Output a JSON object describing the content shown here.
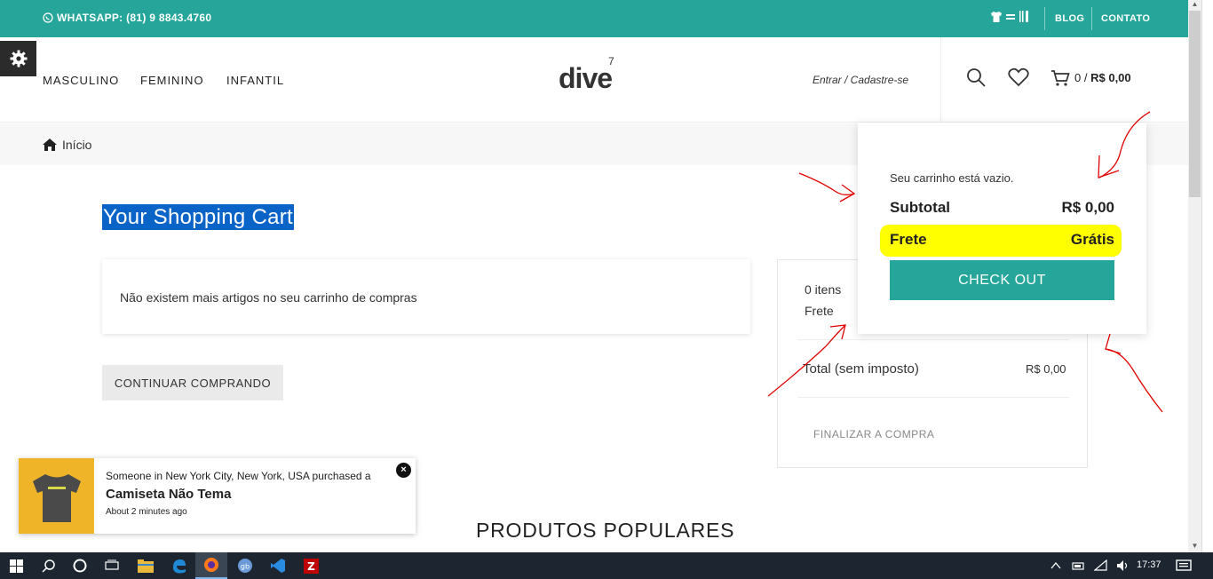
{
  "topbar": {
    "whatsapp": "WHATSAPP: (81) 9 8843.4760",
    "blog": "BLOG",
    "contato": "CONTATO"
  },
  "nav": {
    "items": [
      "MASCULINO",
      "FEMININO",
      "INFANTIL"
    ]
  },
  "logo": {
    "text": "dive",
    "sup": "7"
  },
  "header": {
    "login": "Entrar / Cadastre-se",
    "cart_count": "0",
    "cart_sep": "/",
    "cart_total": "R$ 0,00"
  },
  "breadcrumb": {
    "home": "Início"
  },
  "main": {
    "title": "Your Shopping Cart",
    "empty_message": "Não existem mais artigos no seu carrinho de compras",
    "continue_button": "CONTINUAR COMPRANDO",
    "popular_title": "PRODUTOS POPULARES"
  },
  "summary": {
    "items": "0 itens",
    "frete": "Frete",
    "total_label": "Total (sem imposto)",
    "total_value": "R$ 0,00",
    "finalize": "FINALIZAR A COMPRA"
  },
  "minicart": {
    "empty": "Seu carrinho está vazio.",
    "subtotal_label": "Subtotal",
    "subtotal_value": "R$ 0,00",
    "frete_label": "Frete",
    "frete_value": "Grátis",
    "checkout": "CHECK OUT"
  },
  "toast": {
    "line1": "Someone in New York City, New York, USA purchased a",
    "product": "Camiseta Não Tema",
    "time": "About 2 minutes ago",
    "close": "×"
  },
  "taskbar": {
    "clock": "17:37"
  },
  "colors": {
    "accent": "#26a69a",
    "highlight": "#ffff00",
    "annotation": "#e00000"
  }
}
